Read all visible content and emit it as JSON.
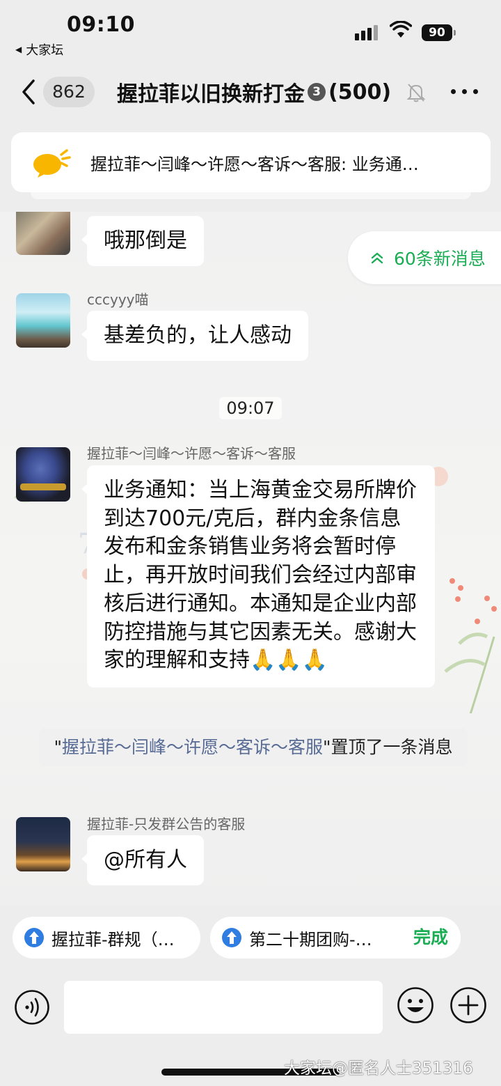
{
  "status_bar": {
    "time": "09:10",
    "back_app": "大家坛",
    "battery": "90"
  },
  "nav": {
    "unread_count": "862",
    "title": "握拉菲以旧换新打金",
    "title_badge": "3",
    "member_count": "(500)",
    "icons": [
      "chevron-left-icon",
      "bell-muted-icon",
      "more-icon"
    ]
  },
  "pinned": {
    "text": "握拉菲～闫峰～许愿～客诉～客服: 业务通…"
  },
  "chat": {
    "new_messages": "60条新消息",
    "time_separator": "09:07",
    "messages": [
      {
        "sender": "",
        "text": "哦那倒是"
      },
      {
        "sender": "cccyyy喵",
        "text": "基差负的，让人感动"
      },
      {
        "sender": "握拉菲～闫峰～许愿～客诉～客服",
        "text": "业务通知：当上海黄金交易所牌价到达700元/克后，群内金条信息发布和金条销售业务将会暂时停止，再开放时间我们会经过内部审核后进行通知。本通知是企业内部防控措施与其它因素无关。感谢大家的理解和支持🙏🙏🙏"
      },
      {
        "sender": "握拉菲-只发群公告的客服",
        "text": "@所有人"
      }
    ],
    "system_message": {
      "quote_open": "\"",
      "name": "握拉菲～闫峰～许愿～客诉～客服",
      "quote_close": "\"",
      "action": "置顶了一条消息"
    }
  },
  "quick_links": {
    "items": [
      "握拉菲-群规（…",
      "第二十期团购-…"
    ],
    "done": "完成"
  },
  "input": {
    "placeholder": ""
  },
  "watermark": "大家坛@匿名人士351316",
  "colors": {
    "accent_green": "#1aad54",
    "link_blue": "#576b95"
  }
}
